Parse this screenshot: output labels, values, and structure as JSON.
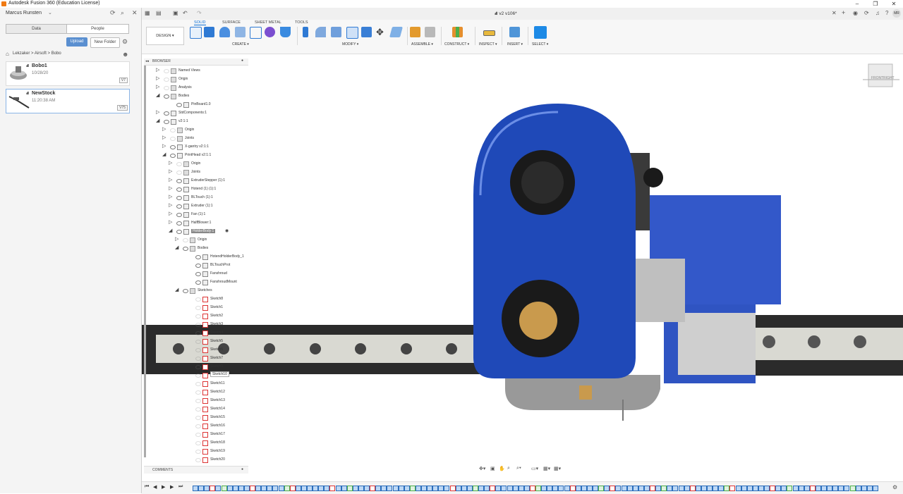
{
  "app": {
    "title": "Autodesk Fusion 360 (Education License)",
    "doc_tab": "v2 v106*"
  },
  "data_panel": {
    "user": "Marcus Runsten",
    "tabs": [
      "Data",
      "People"
    ],
    "upload": "Upload",
    "new_folder": "New Folder",
    "breadcrumb": [
      "Lekzaker",
      "Airsoft",
      "Bobo"
    ],
    "items": [
      {
        "name": "Bobo1",
        "date": "10/28/20",
        "version": "V7"
      },
      {
        "name": "NewStock",
        "date": "11:20:38 AM",
        "version": "V75"
      }
    ]
  },
  "toolbar": {
    "workspace_tabs": [
      "SOLID",
      "SURFACE",
      "SHEET METAL",
      "TOOLS"
    ],
    "design": "DESIGN",
    "groups": [
      "CREATE",
      "MODIFY",
      "ASSEMBLE",
      "CONSTRUCT",
      "INSPECT",
      "INSERT",
      "SELECT"
    ]
  },
  "browser": {
    "title": "BROWSER",
    "comments": "COMMENTS",
    "rows": [
      {
        "label": "Named Views",
        "indent": 0,
        "arrow": "right",
        "eye": false,
        "kind": "folder"
      },
      {
        "label": "Origin",
        "indent": 0,
        "arrow": "right",
        "eye": false,
        "kind": "folder"
      },
      {
        "label": "Analysis",
        "indent": 0,
        "arrow": "right",
        "eye": false,
        "kind": "folder"
      },
      {
        "label": "Bodies",
        "indent": 0,
        "arrow": "down",
        "eye": true,
        "kind": "folder"
      },
      {
        "label": "PinBoard1.0",
        "indent": 2,
        "arrow": "",
        "eye": true,
        "kind": "comp"
      },
      {
        "label": "StdComponents:1",
        "indent": 0,
        "arrow": "right",
        "eye": true,
        "kind": "comp"
      },
      {
        "label": "v2:1:1",
        "indent": 0,
        "arrow": "down",
        "eye": true,
        "kind": "comp"
      },
      {
        "label": "Origin",
        "indent": 1,
        "arrow": "right",
        "eye": false,
        "kind": "folder"
      },
      {
        "label": "Joints",
        "indent": 1,
        "arrow": "right",
        "eye": false,
        "kind": "folder"
      },
      {
        "label": "X-gantry v2:1:1",
        "indent": 1,
        "arrow": "right",
        "eye": true,
        "kind": "comp"
      },
      {
        "label": "PrintHead v2:1:1",
        "indent": 1,
        "arrow": "down",
        "eye": true,
        "kind": "comp"
      },
      {
        "label": "Origin",
        "indent": 2,
        "arrow": "right",
        "eye": false,
        "kind": "folder"
      },
      {
        "label": "Joints",
        "indent": 2,
        "arrow": "right",
        "eye": false,
        "kind": "folder"
      },
      {
        "label": "ExtruderStepper (1):1",
        "indent": 2,
        "arrow": "right",
        "eye": true,
        "kind": "comp"
      },
      {
        "label": "Hotend (1) (1):1",
        "indent": 2,
        "arrow": "right",
        "eye": true,
        "kind": "comp"
      },
      {
        "label": "BLTouch (1):1",
        "indent": 2,
        "arrow": "right",
        "eye": true,
        "kind": "comp"
      },
      {
        "label": "Extruder (1):1",
        "indent": 2,
        "arrow": "right",
        "eye": true,
        "kind": "comp"
      },
      {
        "label": "Fan (1):1",
        "indent": 2,
        "arrow": "right",
        "eye": true,
        "kind": "comp"
      },
      {
        "label": "HalfBlower:1",
        "indent": 2,
        "arrow": "right",
        "eye": true,
        "kind": "comp"
      },
      {
        "label": "HolderBody:1",
        "indent": 2,
        "arrow": "down",
        "eye": true,
        "kind": "comp",
        "highlight": true
      },
      {
        "label": "Origin",
        "indent": 3,
        "arrow": "right",
        "eye": false,
        "kind": "folder"
      },
      {
        "label": "Bodies",
        "indent": 3,
        "arrow": "down",
        "eye": true,
        "kind": "folder"
      },
      {
        "label": "HotendHolderBody_1",
        "indent": 5,
        "arrow": "",
        "eye": true,
        "kind": "body"
      },
      {
        "label": "BLTouchProt",
        "indent": 5,
        "arrow": "",
        "eye": true,
        "kind": "body"
      },
      {
        "label": "Fanshroud",
        "indent": 5,
        "arrow": "",
        "eye": true,
        "kind": "body"
      },
      {
        "label": "FanshroudMount",
        "indent": 5,
        "arrow": "",
        "eye": true,
        "kind": "body"
      },
      {
        "label": "Sketches",
        "indent": 3,
        "arrow": "down",
        "eye": true,
        "kind": "folder"
      },
      {
        "label": "Sketch8",
        "indent": 5,
        "arrow": "",
        "eye": false,
        "kind": "sketch"
      },
      {
        "label": "Sketch1",
        "indent": 5,
        "arrow": "",
        "eye": false,
        "kind": "sketch"
      },
      {
        "label": "Sketch2",
        "indent": 5,
        "arrow": "",
        "eye": false,
        "kind": "sketch"
      },
      {
        "label": "Sketch3",
        "indent": 5,
        "arrow": "",
        "eye": false,
        "kind": "sketch"
      },
      {
        "label": "Sketch4",
        "indent": 5,
        "arrow": "",
        "eye": false,
        "kind": "sketch"
      },
      {
        "label": "Sketch5",
        "indent": 5,
        "arrow": "",
        "eye": false,
        "kind": "sketch"
      },
      {
        "label": "Sketch6",
        "indent": 5,
        "arrow": "",
        "eye": false,
        "kind": "sketch"
      },
      {
        "label": "Sketch7",
        "indent": 5,
        "arrow": "",
        "eye": false,
        "kind": "sketch"
      },
      {
        "label": "Sketch9",
        "indent": 5,
        "arrow": "",
        "eye": false,
        "kind": "sketch"
      },
      {
        "label": "Sketch10",
        "indent": 5,
        "arrow": "",
        "eye": false,
        "kind": "sketch",
        "hover": true
      },
      {
        "label": "Sketch11",
        "indent": 5,
        "arrow": "",
        "eye": false,
        "kind": "sketch"
      },
      {
        "label": "Sketch12",
        "indent": 5,
        "arrow": "",
        "eye": false,
        "kind": "sketch"
      },
      {
        "label": "Sketch13",
        "indent": 5,
        "arrow": "",
        "eye": false,
        "kind": "sketch"
      },
      {
        "label": "Sketch14",
        "indent": 5,
        "arrow": "",
        "eye": false,
        "kind": "sketch"
      },
      {
        "label": "Sketch15",
        "indent": 5,
        "arrow": "",
        "eye": false,
        "kind": "sketch"
      },
      {
        "label": "Sketch16",
        "indent": 5,
        "arrow": "",
        "eye": false,
        "kind": "sketch"
      },
      {
        "label": "Sketch17",
        "indent": 5,
        "arrow": "",
        "eye": false,
        "kind": "sketch"
      },
      {
        "label": "Sketch18",
        "indent": 5,
        "arrow": "",
        "eye": false,
        "kind": "sketch"
      },
      {
        "label": "Sketch19",
        "indent": 5,
        "arrow": "",
        "eye": false,
        "kind": "sketch"
      },
      {
        "label": "Sketch20",
        "indent": 5,
        "arrow": "",
        "eye": false,
        "kind": "sketch"
      }
    ]
  },
  "viewcube": {
    "front": "FRONT",
    "right": "RIGHT"
  },
  "colors": {
    "accent": "#0a6fd6",
    "shroud": "#1f49b8",
    "carriage": "#3358c9",
    "rail": "#2b2b2b",
    "rail_block": "#d9d9d2",
    "brass": "#c99a4d"
  }
}
